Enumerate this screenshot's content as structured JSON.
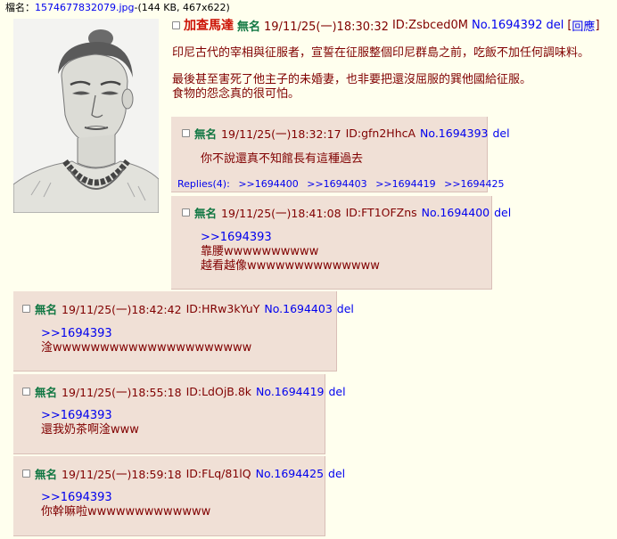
{
  "file": {
    "label": "檔名：",
    "link_text": "1574677832079.jpg",
    "info": "-(144 KB, 467x622)"
  },
  "op": {
    "title": "加查馬達",
    "name": "無名",
    "datetime": "19/11/25(一)18:30:32",
    "id": "ID:Zsbced0M",
    "no": "No.1694392",
    "del": "del",
    "reply_bracket_open": "[",
    "reply_btn": "回應",
    "reply_bracket_close": "]",
    "lines": [
      "印尼古代的宰相與征服者，宣誓在征服整個印尼群島之前，吃飯不加任何調味料。",
      "最後甚至害死了他主子的未婚妻，也非要把還沒屈服的巽他國給征服。",
      "食物的怨念真的很可怕。"
    ]
  },
  "replies": [
    {
      "name": "無名",
      "datetime": "19/11/25(一)18:32:17",
      "id": "ID:gfn2HhcA",
      "no": "No.1694393",
      "del": "del",
      "quote": "",
      "lines": [
        "你不說還真不知館長有這種過去"
      ],
      "replies_label": "Replies(4):",
      "reply_links": [
        ">>1694400",
        ">>1694403",
        ">>1694419",
        ">>1694425"
      ]
    },
    {
      "name": "無名",
      "datetime": "19/11/25(一)18:41:08",
      "id": "ID:FT1OFZns",
      "no": "No.1694400",
      "del": "del",
      "quote": ">>1694393",
      "lines": [
        "靠腰wwwwwwwwww",
        "越看越像wwwwwwwwwwwwww"
      ]
    },
    {
      "name": "無名",
      "datetime": "19/11/25(一)18:42:42",
      "id": "ID:HRw3kYuY",
      "no": "No.1694403",
      "del": "del",
      "quote": ">>1694393",
      "lines": [
        "淦wwwwwwwwwwwwwwwwwwwww"
      ]
    },
    {
      "name": "無名",
      "datetime": "19/11/25(一)18:55:18",
      "id": "ID:LdOjB.8k",
      "no": "No.1694419",
      "del": "del",
      "quote": ">>1694393",
      "lines": [
        "還我奶茶啊淦www"
      ]
    },
    {
      "name": "無名",
      "datetime": "19/11/25(一)18:59:18",
      "id": "ID:FLq/81lQ",
      "no": "No.1694425",
      "del": "del",
      "quote": ">>1694393",
      "lines": [
        "你幹嘛啦wwwwwwwwwwwww"
      ]
    }
  ]
}
